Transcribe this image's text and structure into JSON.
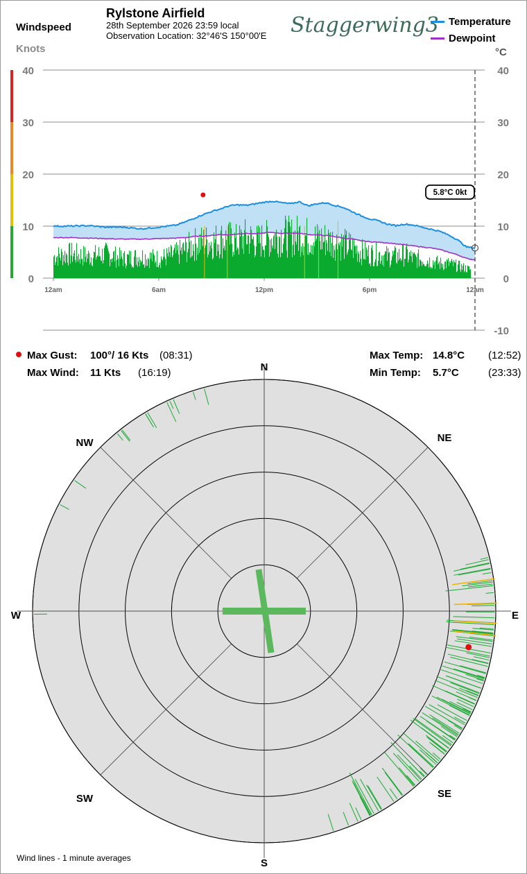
{
  "header": {
    "title": "Rylstone Airfield",
    "datetime": "28th September 2026  23:59 local",
    "location": "Observation Location:  32°46'S 150°00'E"
  },
  "brand": {
    "logo_text": "Staggerwing3"
  },
  "left_axis": {
    "label": "Windspeed",
    "units": "Knots"
  },
  "right_axis": {
    "units": "°C"
  },
  "legend": [
    {
      "label": "Temperature",
      "color": "#1a8ee0"
    },
    {
      "label": "Dewpoint",
      "color": "#a030c8"
    }
  ],
  "current_badge": "5.8°C  0kt",
  "colors": {
    "temperature": "#1a8ee0",
    "temp_fill": "#bfe0f5",
    "dewpoint": "#a030c8",
    "wind": "#0aaa2e",
    "gust": "#f0b400",
    "max_gust": "#e01010",
    "rose_bg": "#e0e0e0",
    "rose_line": "#5cb85c"
  },
  "stats": {
    "max_gust": {
      "label": "Max Gust:",
      "value": "100°/  16 Kts",
      "time": "(08:31)"
    },
    "max_wind": {
      "label": "Max Wind:",
      "value": "11 Kts",
      "time": "(16:19)"
    },
    "max_temp": {
      "label": "Max Temp:",
      "value": "14.8°C",
      "time": "(12:52)"
    },
    "min_temp": {
      "label": "Min Temp:",
      "value": "5.7°C",
      "time": "(23:33)"
    }
  },
  "compass": [
    "N",
    "NE",
    "E",
    "SE",
    "S",
    "SW",
    "W",
    "NW"
  ],
  "footer": "Wind lines - 1 minute averages",
  "chart_data": {
    "type": "line",
    "x_ticks": [
      "12am",
      "6am",
      "12pm",
      "6pm",
      "12am"
    ],
    "wind_ylim": [
      0,
      40
    ],
    "wind_ticks": [
      0,
      10,
      20,
      30,
      40
    ],
    "temp_ylim": [
      -10,
      40
    ],
    "temp_ticks": [
      -10,
      0,
      10,
      20,
      30,
      40
    ],
    "wind_color_bands": [
      {
        "from": 0,
        "to": 10,
        "color": "#22aa33"
      },
      {
        "from": 10,
        "to": 20,
        "color": "#e6c000"
      },
      {
        "from": 20,
        "to": 30,
        "color": "#ee8822"
      },
      {
        "from": 30,
        "to": 40,
        "color": "#dd2222"
      }
    ],
    "x_hours": [
      0,
      1,
      2,
      3,
      4,
      5,
      6,
      7,
      7.5,
      8,
      8.5,
      9,
      9.5,
      10,
      10.5,
      11,
      11.5,
      12,
      12.5,
      13,
      13.5,
      14,
      14.5,
      15,
      15.5,
      16,
      16.5,
      17,
      17.5,
      18,
      18.5,
      19,
      19.5,
      20,
      20.5,
      21,
      21.5,
      22,
      22.5,
      23,
      23.5,
      24
    ],
    "series": [
      {
        "name": "Temperature",
        "unit": "°C",
        "values": [
          10,
          10,
          10.1,
          9.8,
          9.8,
          9.5,
          9.8,
          10.2,
          10.8,
          11.5,
          12.2,
          12.8,
          13.3,
          13.9,
          14.1,
          14.0,
          14.3,
          14.6,
          14.8,
          14.5,
          14.3,
          14.7,
          13.9,
          14.3,
          14.5,
          14.0,
          13.6,
          12.8,
          12.0,
          11.4,
          11.0,
          10.4,
          10.1,
          10.4,
          10.2,
          9.8,
          9.4,
          9.0,
          8.3,
          7.4,
          6.0,
          5.8
        ]
      },
      {
        "name": "Dewpoint",
        "unit": "°C",
        "values": [
          7.8,
          7.8,
          7.7,
          7.6,
          7.5,
          7.5,
          7.6,
          7.7,
          7.8,
          8.0,
          8.1,
          8.2,
          8.4,
          8.3,
          8.5,
          8.6,
          8.5,
          8.7,
          8.8,
          8.6,
          8.7,
          8.6,
          8.4,
          8.3,
          8.2,
          8.0,
          7.7,
          7.5,
          7.2,
          7.0,
          6.9,
          6.8,
          6.6,
          6.4,
          6.2,
          6.0,
          5.8,
          5.5,
          5.0,
          4.5,
          3.8,
          3.5
        ]
      },
      {
        "name": "Windspeed",
        "unit": "Kts",
        "values": [
          4.5,
          5,
          4.5,
          5,
          4,
          4.5,
          4,
          5,
          6,
          7,
          7.5,
          7.5,
          8,
          8,
          7.5,
          8.5,
          7.5,
          8,
          8.5,
          9,
          8.5,
          9,
          8.5,
          8,
          8,
          7.5,
          7,
          6.5,
          5.5,
          5,
          5,
          4.5,
          4.5,
          5,
          4,
          4,
          3.5,
          3,
          3,
          2.5,
          2,
          1.5
        ]
      }
    ],
    "gust_markers": [
      {
        "hour": 8.6,
        "kts": 10
      },
      {
        "hour": 9.9,
        "kts": 10
      },
      {
        "hour": 14.3,
        "kts": 10
      },
      {
        "hour": 15.1,
        "kts": 10
      },
      {
        "hour": 16.2,
        "kts": 11
      }
    ],
    "max_gust_point": {
      "hour": 8.52,
      "kts": 16
    },
    "wind_rose": {
      "ring_ticks": [
        5,
        10,
        15,
        20,
        25
      ],
      "max_kts": 25,
      "direction_sectors": [
        {
          "dir_deg": 80,
          "count": 12
        },
        {
          "dir_deg": 90,
          "count": 9
        },
        {
          "dir_deg": 100,
          "count": 16
        },
        {
          "dir_deg": 110,
          "count": 20
        },
        {
          "dir_deg": 120,
          "count": 22
        },
        {
          "dir_deg": 130,
          "count": 18
        },
        {
          "dir_deg": 140,
          "count": 14
        },
        {
          "dir_deg": 150,
          "count": 10
        },
        {
          "dir_deg": 160,
          "count": 4
        },
        {
          "dir_deg": 270,
          "count": 1
        },
        {
          "dir_deg": 300,
          "count": 2
        },
        {
          "dir_deg": 325,
          "count": 6
        },
        {
          "dir_deg": 340,
          "count": 5
        }
      ],
      "gust_direction_deg": 100,
      "gust_kts": 16
    }
  }
}
